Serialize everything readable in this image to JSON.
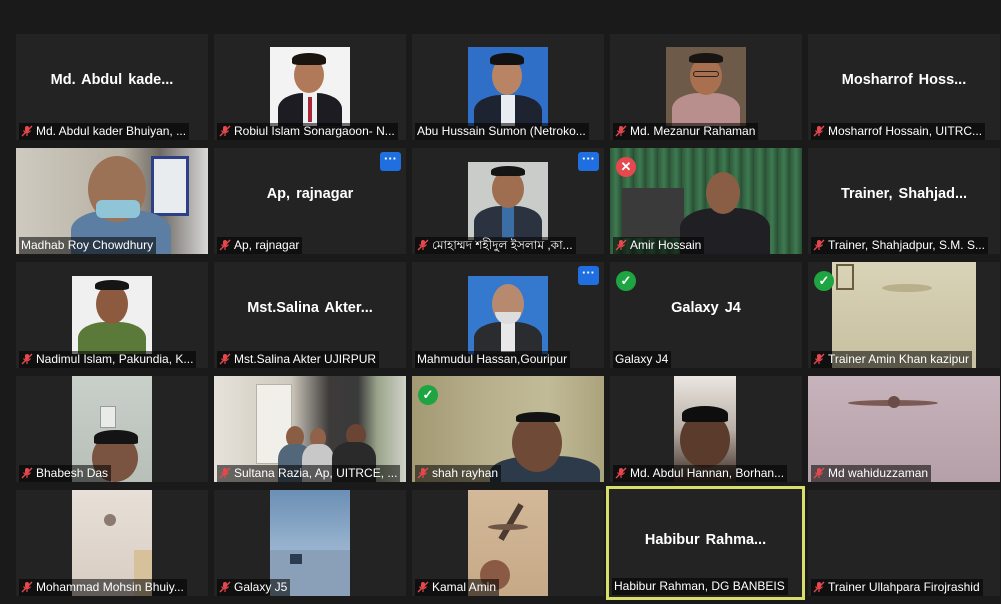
{
  "tiles": [
    {
      "caption": "Md. Abdul kader Bhuiyan, ...",
      "display_name": "Md.  Abdul  kade...",
      "muted": true,
      "kind": "name"
    },
    {
      "caption": "Robiul Islam Sonargaoon- N...",
      "muted": true,
      "kind": "portrait"
    },
    {
      "caption": "Abu Hussain Sumon (Netroko...",
      "muted": false,
      "kind": "portrait"
    },
    {
      "caption": "Md. Mezanur Rahaman",
      "muted": true,
      "kind": "portrait"
    },
    {
      "caption": "Mosharrof Hossain, UITRC...",
      "display_name": "Mosharrof  Hoss...",
      "muted": true,
      "kind": "name"
    },
    {
      "caption": "Madhab Roy Chowdhury",
      "muted": false,
      "kind": "video"
    },
    {
      "caption": "Ap, rajnagar",
      "display_name": "Ap, rajnagar",
      "muted": true,
      "kind": "name",
      "menu": "···"
    },
    {
      "caption": "মোহাম্মদ শহীদুল ইসলাম ,কা...",
      "muted": true,
      "kind": "portrait",
      "menu": "···"
    },
    {
      "caption": "Amir Hossain",
      "muted": true,
      "kind": "video",
      "badge": "no",
      "badge_symbol": "✕"
    },
    {
      "caption": "Trainer, Shahjadpur, S.M. S...",
      "display_name": "Trainer,  Shahjad...",
      "muted": true,
      "kind": "name"
    },
    {
      "caption": "Nadimul Islam, Pakundia, K...",
      "muted": true,
      "kind": "portrait"
    },
    {
      "caption": "Mst.Salina Akter UJIRPUR",
      "display_name": "Mst.Salina  Akter...",
      "muted": true,
      "kind": "name"
    },
    {
      "caption": "Mahmudul Hassan,Gouripur",
      "muted": false,
      "kind": "portrait",
      "menu": "···"
    },
    {
      "caption": "Galaxy J4",
      "display_name": "Galaxy J4",
      "muted": false,
      "kind": "name",
      "badge": "ok",
      "badge_symbol": "✓"
    },
    {
      "caption": "Trainer Amin Khan kazipur",
      "muted": true,
      "kind": "video",
      "badge": "ok",
      "badge_symbol": "✓"
    },
    {
      "caption": "Bhabesh Das",
      "muted": true,
      "kind": "video"
    },
    {
      "caption": "Sultana Razia, Ap, UITRCE, ...",
      "muted": true,
      "kind": "video"
    },
    {
      "caption": "shah rayhan",
      "muted": true,
      "kind": "video",
      "badge": "ok",
      "badge_symbol": "✓"
    },
    {
      "caption": "Md. Abdul Hannan, Borhan...",
      "muted": true,
      "kind": "video"
    },
    {
      "caption": "Md wahiduzzaman",
      "muted": true,
      "kind": "video"
    },
    {
      "caption": "Mohammad Mohsin Bhuiy...",
      "muted": true,
      "kind": "video"
    },
    {
      "caption": "Galaxy J5",
      "muted": true,
      "kind": "video"
    },
    {
      "caption": "Kamal Amin",
      "muted": true,
      "kind": "video"
    },
    {
      "caption": "Habibur Rahman, DG BANBEIS",
      "display_name": "Habibur  Rahma...",
      "muted": false,
      "kind": "name",
      "active": true
    },
    {
      "caption": "Trainer Ullahpara Firojrashid",
      "muted": true,
      "kind": "name"
    }
  ],
  "colors": {
    "background": "#1a1a1a",
    "tile": "#232323",
    "active_border": "#d8de6a",
    "mute_icon": "#e5484d",
    "menu_button": "#1f6fe0"
  }
}
